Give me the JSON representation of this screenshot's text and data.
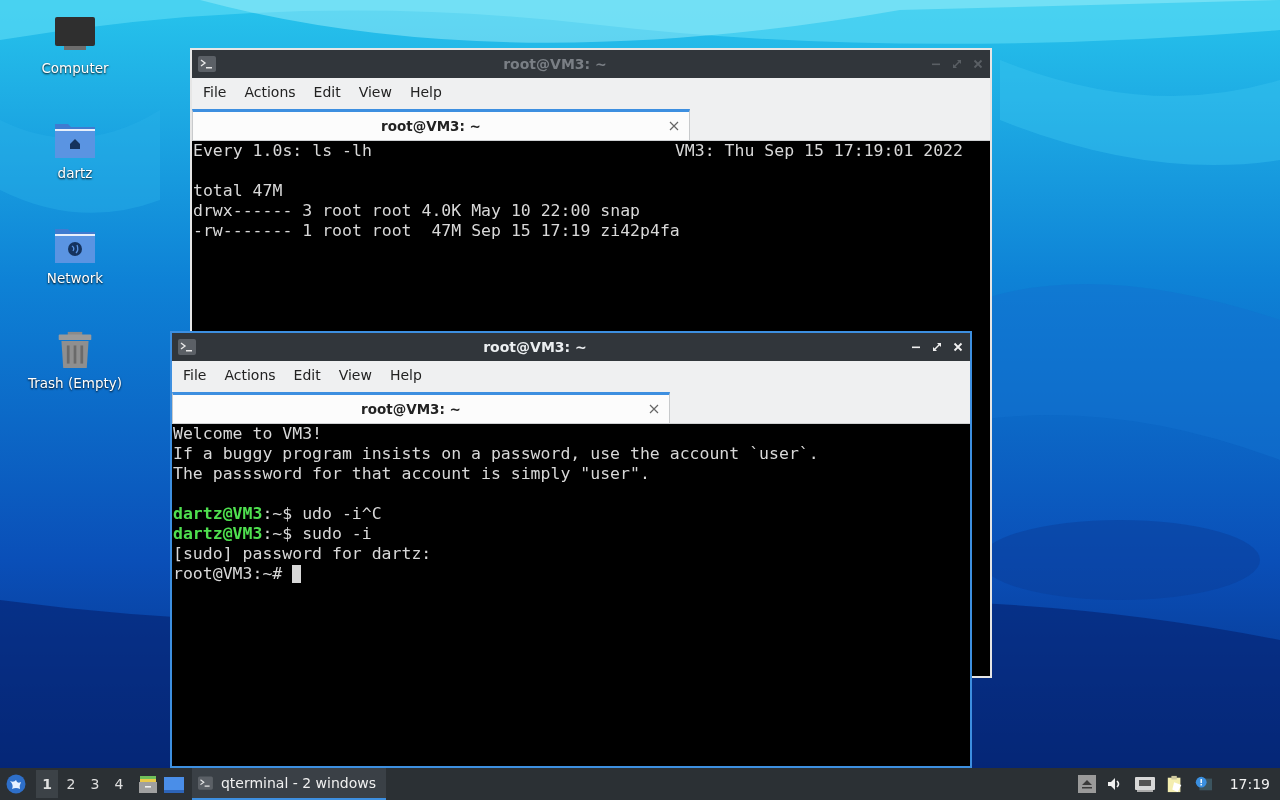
{
  "desktop_icons": [
    {
      "label": "Computer",
      "kind": "computer"
    },
    {
      "label": "dartz",
      "kind": "home"
    },
    {
      "label": "Network",
      "kind": "network"
    },
    {
      "label": "Trash (Empty)",
      "kind": "trash"
    }
  ],
  "windows": [
    {
      "title": "root@VM3: ~",
      "active": false,
      "menu": [
        "File",
        "Actions",
        "Edit",
        "View",
        "Help"
      ],
      "tabs": [
        {
          "label": "root@VM3: ~",
          "selected": true
        }
      ],
      "header": {
        "left": "Every 1.0s: ls -lh",
        "right": "VM3: Thu Sep 15 17:19:01 2022"
      },
      "lines": [
        {
          "kind": "blank"
        },
        {
          "kind": "text",
          "text": "total 47M"
        },
        {
          "kind": "text",
          "text": "drwx------ 3 root root 4.0K May 10 22:00 snap"
        },
        {
          "kind": "text",
          "text": "-rw------- 1 root root  47M Sep 15 17:19 zi42p4fa"
        }
      ]
    },
    {
      "title": "root@VM3: ~",
      "active": true,
      "menu": [
        "File",
        "Actions",
        "Edit",
        "View",
        "Help"
      ],
      "tabs": [
        {
          "label": "root@VM3: ~",
          "selected": true
        }
      ],
      "lines": [
        {
          "kind": "text",
          "text": "Welcome to VM3!"
        },
        {
          "kind": "text",
          "text": "If a buggy program insists on a password, use the account `user`."
        },
        {
          "kind": "text",
          "text": "The passsword for that account is simply \"user\"."
        },
        {
          "kind": "blank"
        },
        {
          "kind": "text",
          "prompt": "dartz@VM3",
          "text": ":~$ udo -i^C"
        },
        {
          "kind": "text",
          "prompt": "dartz@VM3",
          "text": ":~$ sudo -i"
        },
        {
          "kind": "text",
          "text": "[sudo] password for dartz:"
        },
        {
          "kind": "text",
          "text": "root@VM3:~# "
        }
      ],
      "cursor": true
    }
  ],
  "taskbar": {
    "workspaces": [
      {
        "label": "1",
        "selected": true
      },
      {
        "label": "2",
        "selected": false
      },
      {
        "label": "3",
        "selected": false
      },
      {
        "label": "4",
        "selected": false
      }
    ],
    "task": {
      "label": "qterminal - 2 windows",
      "selected": true
    },
    "clock": "17:19"
  }
}
